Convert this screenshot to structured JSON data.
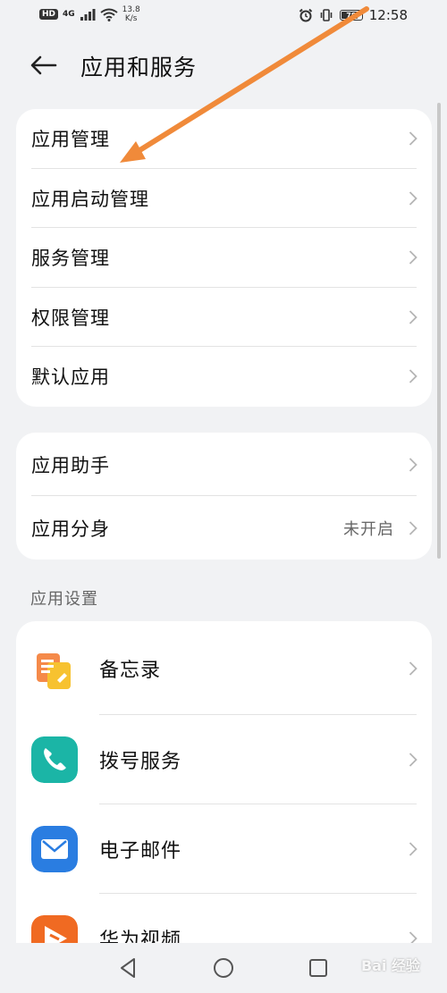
{
  "status_bar": {
    "hd": "HD",
    "signal": "4G",
    "speed_value": "13.8",
    "speed_unit": "K/s",
    "battery": "78",
    "time": "12:58"
  },
  "header": {
    "title": "应用和服务"
  },
  "group1": [
    {
      "label": "应用管理"
    },
    {
      "label": "应用启动管理"
    },
    {
      "label": "服务管理"
    },
    {
      "label": "权限管理"
    },
    {
      "label": "默认应用"
    }
  ],
  "group2": [
    {
      "label": "应用助手",
      "value": ""
    },
    {
      "label": "应用分身",
      "value": "未开启"
    }
  ],
  "app_settings": {
    "header": "应用设置",
    "items": [
      {
        "label": "备忘录",
        "icon": "notepad-icon"
      },
      {
        "label": "拨号服务",
        "icon": "phone-icon"
      },
      {
        "label": "电子邮件",
        "icon": "mail-icon"
      },
      {
        "label": "华为视频",
        "icon": "video-icon"
      }
    ]
  },
  "watermark": "Bai 经验",
  "colors": {
    "background": "#f1f2f4",
    "card": "#ffffff",
    "annotation_arrow": "#f08a3a",
    "phone_icon": "#1bb5a6",
    "mail_icon": "#2a7de1",
    "video_icon": "#f06a22"
  }
}
